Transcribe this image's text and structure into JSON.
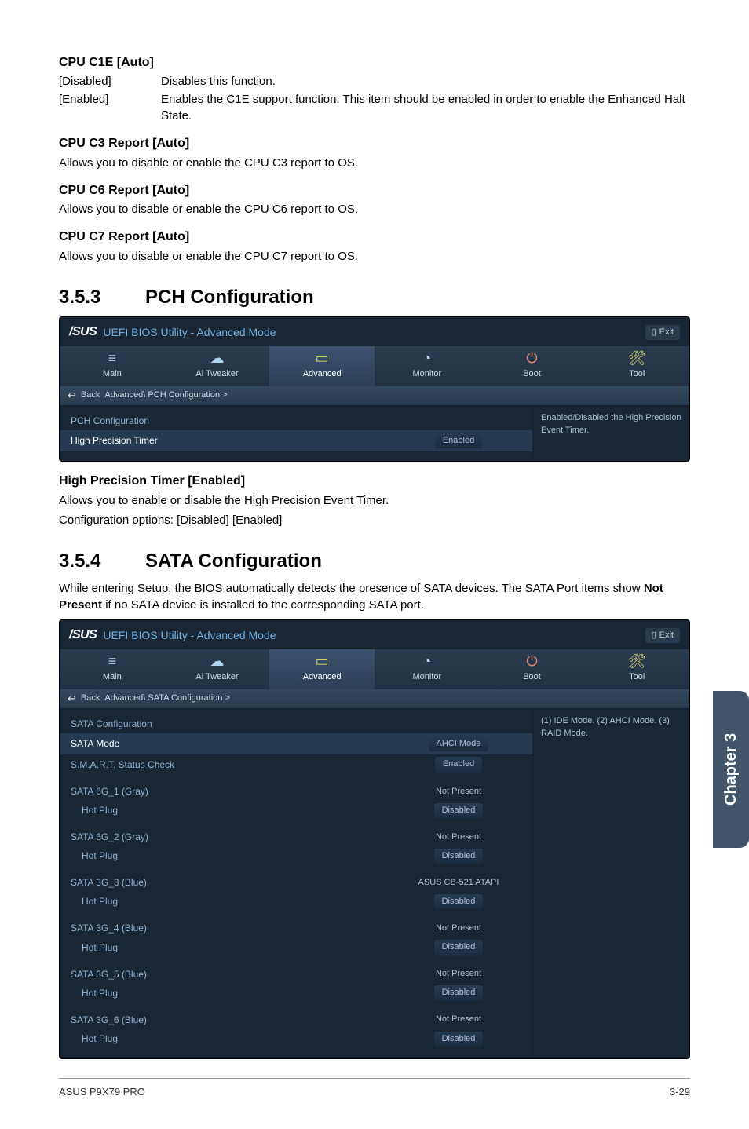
{
  "cpu_c1e": {
    "title": "CPU C1E [Auto]",
    "opts": [
      {
        "k": "[Disabled]",
        "v": "Disables this function."
      },
      {
        "k": "[Enabled]",
        "v": "Enables the C1E support function. This item should be enabled in order to enable the Enhanced Halt State."
      }
    ]
  },
  "c3": {
    "title": "CPU C3 Report [Auto]",
    "body": "Allows you to disable or enable the CPU C3 report to OS."
  },
  "c6": {
    "title": "CPU C6 Report [Auto]",
    "body": "Allows you to disable or enable the CPU C6 report to OS."
  },
  "c7": {
    "title": "CPU C7 Report [Auto]",
    "body": "Allows you to disable or enable the CPU C7 report to OS."
  },
  "sec353": {
    "num": "3.5.3",
    "title": "PCH Configuration"
  },
  "sec354": {
    "num": "3.5.4",
    "title": "SATA Configuration"
  },
  "hpt": {
    "title": "High Precision Timer [Enabled]",
    "l1": "Allows you to enable or disable the High Precision Event Timer.",
    "l2": "Configuration options: [Disabled] [Enabled]"
  },
  "sata_intro_a": "While entering Setup, the BIOS automatically detects the presence of SATA devices. The SATA Port items show ",
  "sata_intro_b": "Not Present",
  "sata_intro_c": " if no SATA device is installed to the corresponding SATA port.",
  "bios_common": {
    "logo": "/SUS",
    "header_title": "UEFI BIOS Utility - Advanced Mode",
    "exit": "Exit",
    "tabs": {
      "main": "Main",
      "ai": "Ai  Tweaker",
      "adv": "Advanced",
      "mon": "Monitor",
      "boot": "Boot",
      "tool": "Tool"
    },
    "back": "Back"
  },
  "bios1": {
    "breadcrumb": "Advanced\\  PCH Configuration  >",
    "heading": "PCH Configuration",
    "row_label": "High Precision Timer",
    "row_value": "Enabled",
    "help": "Enabled/Disabled the High Precision Event Timer."
  },
  "bios2": {
    "breadcrumb": "Advanced\\  SATA Configuration  >",
    "heading": "SATA Configuration",
    "mode_label": "SATA Mode",
    "mode_value": "AHCI Mode",
    "smart_label": "S.M.A.R.T. Status Check",
    "smart_value": "Enabled",
    "help": "(1) IDE Mode. (2) AHCI Mode. (3) RAID Mode.",
    "ports": [
      {
        "name": "SATA 6G_1 (Gray)",
        "sub": "Hot Plug",
        "v1": "Not Present",
        "v2": "Disabled"
      },
      {
        "name": "SATA 6G_2 (Gray)",
        "sub": "Hot Plug",
        "v1": "Not Present",
        "v2": "Disabled"
      },
      {
        "name": "SATA 3G_3 (Blue)",
        "sub": "Hot Plug",
        "v1": "ASUS   CB-521 ATAPI",
        "v2": "Disabled"
      },
      {
        "name": "SATA 3G_4 (Blue)",
        "sub": "Hot Plug",
        "v1": "Not Present",
        "v2": "Disabled"
      },
      {
        "name": "SATA 3G_5 (Blue)",
        "sub": "Hot Plug",
        "v1": "Not Present",
        "v2": "Disabled"
      },
      {
        "name": "SATA 3G_6 (Blue)",
        "sub": "Hot Plug",
        "v1": "Not Present",
        "v2": "Disabled"
      }
    ]
  },
  "side_tab": "Chapter 3",
  "footer_left": "ASUS P9X79 PRO",
  "footer_right": "3-29"
}
